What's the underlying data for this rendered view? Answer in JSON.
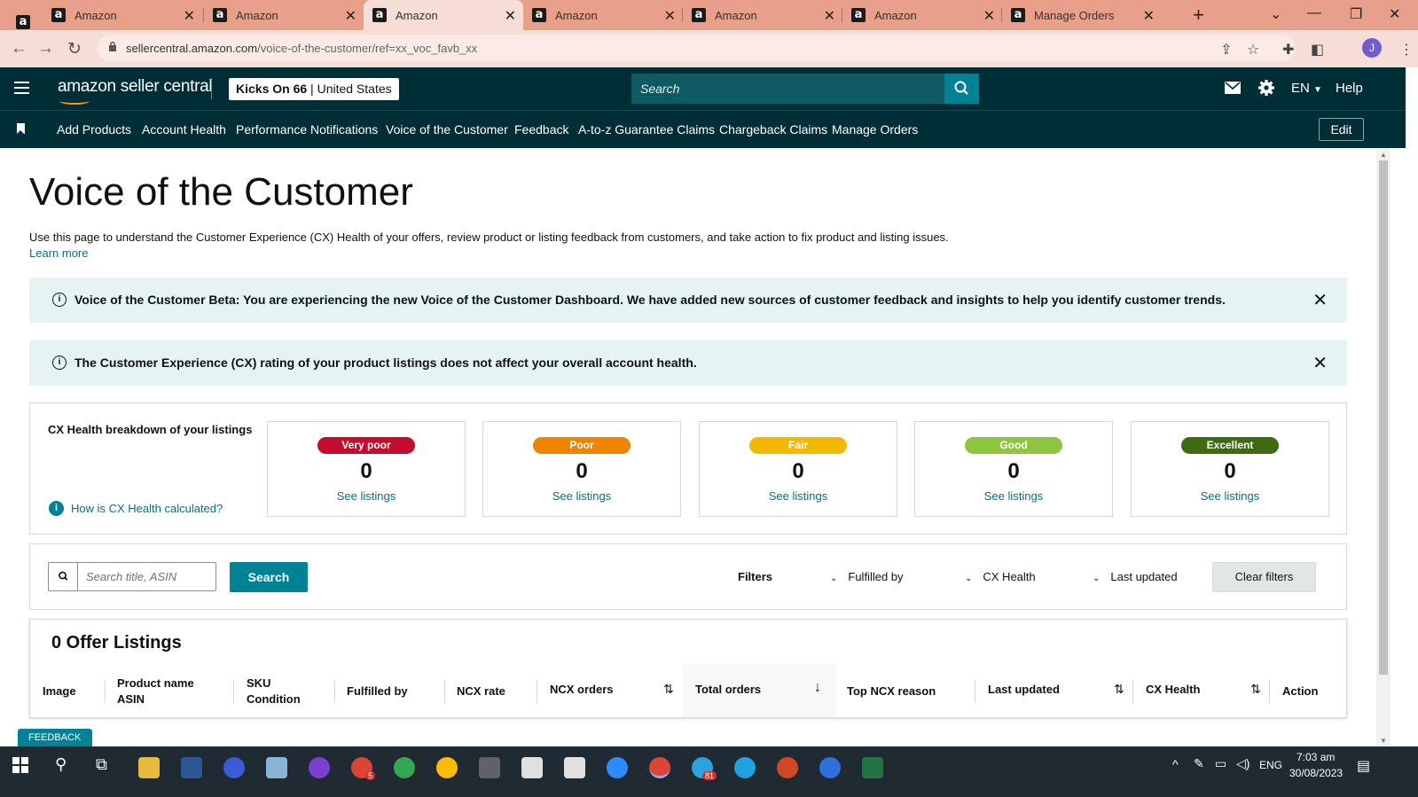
{
  "browser": {
    "tabs": [
      {
        "title": "Amazon"
      },
      {
        "title": "Amazon"
      },
      {
        "title": "Amazon"
      },
      {
        "title": "Amazon"
      },
      {
        "title": "Amazon"
      },
      {
        "title": "Amazon"
      },
      {
        "title": "Manage Orders"
      }
    ],
    "url_host": "sellercentral.amazon.com",
    "url_path": "/voice-of-the-customer/ref=xx_voc_favb_xx",
    "profile_initial": "J"
  },
  "header": {
    "logo_text": "amazon seller central",
    "store_name": "Kicks On 66",
    "store_region": "United States",
    "search_placeholder": "Search",
    "language": "EN",
    "help_label": "Help"
  },
  "subnav": {
    "links": [
      "Add Products",
      "Account Health",
      "Performance Notifications",
      "Voice of the Customer",
      "Feedback",
      "A-to-z Guarantee Claims",
      "Chargeback Claims",
      "Manage Orders"
    ],
    "edit_label": "Edit"
  },
  "page": {
    "title": "Voice of the Customer",
    "description": "Use this page to understand the Customer Experience (CX) Health of your offers, review product or listing feedback from customers, and take action to fix product and listing issues.",
    "learn_more": "Learn more",
    "alerts": [
      {
        "text": "Voice of the Customer Beta: You are experiencing the new Voice of the Customer Dashboard. We have added new sources of customer feedback and insights to help you identify customer trends."
      },
      {
        "text": "The Customer Experience (CX) rating of your product listings does not affect your overall account health."
      }
    ]
  },
  "cx_health": {
    "title": "CX Health breakdown of your listings",
    "how_link": "How is CX Health calculated?",
    "cards": [
      {
        "label": "Very poor",
        "count": "0",
        "link": "See listings",
        "color": "#c40c2f"
      },
      {
        "label": "Poor",
        "count": "0",
        "link": "See listings",
        "color": "#f08300"
      },
      {
        "label": "Fair",
        "count": "0",
        "link": "See listings",
        "color": "#f5b800"
      },
      {
        "label": "Good",
        "count": "0",
        "link": "See listings",
        "color": "#8ec63f"
      },
      {
        "label": "Excellent",
        "count": "0",
        "link": "See listings",
        "color": "#3d6b12"
      }
    ]
  },
  "filters": {
    "search_placeholder": "Search title, ASIN",
    "search_button": "Search",
    "label": "Filters",
    "dropdowns": [
      "Fulfilled by",
      "CX Health",
      "Last updated"
    ],
    "clear_label": "Clear filters"
  },
  "table": {
    "title": "0 Offer Listings",
    "columns": [
      {
        "line1": "Image",
        "line2": ""
      },
      {
        "line1": "Product name",
        "line2": "ASIN"
      },
      {
        "line1": "SKU",
        "line2": "Condition"
      },
      {
        "line1": "Fulfilled by",
        "line2": ""
      },
      {
        "line1": "NCX rate",
        "line2": ""
      },
      {
        "line1": "NCX orders",
        "line2": ""
      },
      {
        "line1": "Total orders",
        "line2": ""
      },
      {
        "line1": "Top NCX reason",
        "line2": ""
      },
      {
        "line1": "Last updated",
        "line2": ""
      },
      {
        "line1": "CX Health",
        "line2": ""
      },
      {
        "line1": "Action",
        "line2": ""
      }
    ]
  },
  "feedback_tab": "FEEDBACK",
  "taskbar": {
    "language": "ENG",
    "time": "7:03 am",
    "date": "30/08/2023",
    "badges": {
      "chrome": "5",
      "telegram": "81"
    }
  },
  "colors": {
    "header_bg": "#002e36",
    "accent": "#008296",
    "link": "#007185",
    "alert_bg": "#e6f3f5",
    "tab_strip": "#e9a08a"
  }
}
